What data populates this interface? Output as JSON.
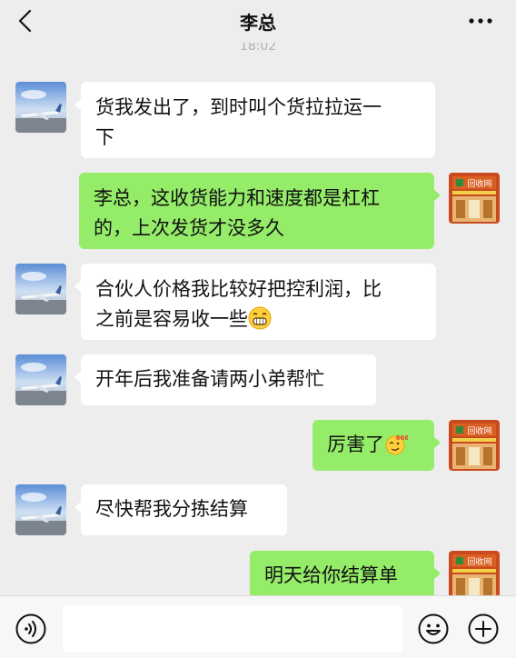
{
  "header": {
    "title": "李总",
    "back_icon": "chevron-left-icon",
    "more_icon": "more-dots-icon"
  },
  "timestamp": "18:02",
  "messages": [
    {
      "side": "in",
      "text": "货我发出了，到时叫个货拉拉运一下",
      "line1": "货我发出了，到时叫个货拉拉运一",
      "line2": "下"
    },
    {
      "side": "out",
      "line1": "李总，这收货能力和速度都是杠杠",
      "line2": "的，上次发货才没多久"
    },
    {
      "side": "in",
      "line1": "合伙人价格我比较好把控利润，比",
      "line2": "之前是容易收一些",
      "emoji": "grinning-emoji"
    },
    {
      "side": "in",
      "text": "开年后我准备请两小弟帮忙"
    },
    {
      "side": "out",
      "text": "厉害了",
      "emoji": "666-emoji"
    },
    {
      "side": "in",
      "text": "尽快帮我分拣结算"
    },
    {
      "side": "out",
      "text": "明天给你结算单"
    }
  ],
  "avatars": {
    "contact_icon": "airplane-photo-avatar",
    "me_icon": "recycle-shop-avatar",
    "me_sign_text": "回收网"
  },
  "input_bar": {
    "voice_icon": "voice-icon",
    "emoji_icon": "smile-icon",
    "plus_icon": "plus-icon",
    "value": ""
  },
  "colors": {
    "background": "#ededed",
    "incoming_bubble": "#ffffff",
    "outgoing_bubble": "#95ec69"
  }
}
